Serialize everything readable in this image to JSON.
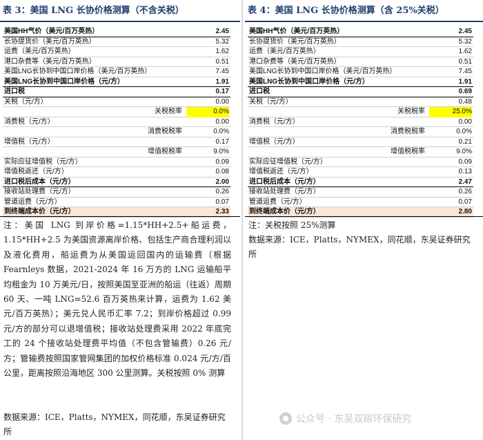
{
  "left": {
    "title": "表 3：美国 LNG 长协价格测算（不含关税）",
    "rows": [
      {
        "label": "美国HH气价（美元/百万英热）",
        "value": "2.45",
        "style": "b"
      },
      {
        "label": "长协提货价（美元/百万英热）",
        "value": "5.32",
        "style": ""
      },
      {
        "label": "运费（美元/百万英热）",
        "value": "1.62",
        "style": ""
      },
      {
        "label": "港口杂费等（美元/百万英热）",
        "value": "0.51",
        "style": ""
      },
      {
        "label": "美国LNG长协到中国口岸价格（美元/百万英热）",
        "value": "7.45",
        "style": ""
      },
      {
        "label": "美国LNG长协到中国口岸价格（元/方）",
        "value": "1.91",
        "style": "b"
      },
      {
        "label": "进口税",
        "value": "0.17",
        "style": "b"
      },
      {
        "label": "关税（元/方）",
        "value": "0.00",
        "style": ""
      },
      {
        "label": "关税税率",
        "value": "0.0%",
        "style": "ind hl"
      },
      {
        "label": "消费税（元/方）",
        "value": "0.00",
        "style": ""
      },
      {
        "label": "消费税税率",
        "value": "0.0%",
        "style": "ind"
      },
      {
        "label": "增值税（元/方）",
        "value": "0.17",
        "style": ""
      },
      {
        "label": "增值税税率",
        "value": "9.0%",
        "style": "ind"
      },
      {
        "label": "实际应征增值税（元/方）",
        "value": "0.09",
        "style": ""
      },
      {
        "label": "增值税返还（元/方）",
        "value": "0.08",
        "style": ""
      },
      {
        "label": "进口税后成本（元/方）",
        "value": "2.00",
        "style": "b"
      },
      {
        "label": "接收站处理费（元/方）",
        "value": "0.26",
        "style": ""
      },
      {
        "label": "管道运费（元/方）",
        "value": "0.07",
        "style": ""
      },
      {
        "label": "到终端成本价（元/方）",
        "value": "2.33",
        "style": "total"
      }
    ],
    "note": "注：美国 LNG 到岸价格=1.15*HH+2.5+船运费，1.15*HH+2.5 为美国资源离岸价格、包括生产商合理利润以及液化费用，船运费为从美国运回国内的运输费（根据 Fearnleys 数据，2021-2024 年 16 万方的 LNG 运输船平均租金为 10 万美元/日，按照美国至亚洲的船运（往返）周期 60 天、一吨 LNG=52.6 百万英热来计算，运费为 1.62 美元/百万英热）；美元兑人民币汇率 7.2；到岸价格超过 0.99 元/方的部分可以退增值税；接收站处理费采用 2022 年底完工的 24 个接收站处理费平均值（不包含管输费）0.26 元/方；管输费按照国家管网集团的加权价格标准 0.024 元/方/百公里，距离按照沿海地区 300 公里测算。关税按照 0% 测算",
    "source": "数据来源：ICE，Platts，NYMEX，同花顺，东吴证券研究所"
  },
  "right": {
    "title": "表 4：美国 LNG 长协价格测算（含 25%关税）",
    "rows": [
      {
        "label": "美国HH气价（美元/百万英热）",
        "value": "2.45",
        "style": "b"
      },
      {
        "label": "长协提货价（美元/百万英热）",
        "value": "5.32",
        "style": ""
      },
      {
        "label": "运费（美元/百万英热）",
        "value": "1.62",
        "style": ""
      },
      {
        "label": "港口杂费等（美元/百万英热）",
        "value": "0.51",
        "style": ""
      },
      {
        "label": "美国LNG长协到中国口岸价格（美元/百万英热）",
        "value": "7.45",
        "style": ""
      },
      {
        "label": "美国LNG长协到中国口岸价格（元/方）",
        "value": "1.91",
        "style": "b"
      },
      {
        "label": "进口税",
        "value": "0.69",
        "style": "b"
      },
      {
        "label": "关税（元/方）",
        "value": "0.48",
        "style": ""
      },
      {
        "label": "关税税率",
        "value": "25.0%",
        "style": "ind hl"
      },
      {
        "label": "消费税（元/方）",
        "value": "0.00",
        "style": ""
      },
      {
        "label": "消费税税率",
        "value": "0.0%",
        "style": "ind"
      },
      {
        "label": "增值税（元/方）",
        "value": "0.21",
        "style": ""
      },
      {
        "label": "增值税税率",
        "value": "9.0%",
        "style": "ind"
      },
      {
        "label": "实际应征增值税（元/方）",
        "value": "0.09",
        "style": ""
      },
      {
        "label": "增值税返还（元/方）",
        "value": "0.13",
        "style": ""
      },
      {
        "label": "进口税后成本（元/方）",
        "value": "2.47",
        "style": "b"
      },
      {
        "label": "接收站处理费（元/方）",
        "value": "0.26",
        "style": ""
      },
      {
        "label": "管道运费（元/方）",
        "value": "0.07",
        "style": ""
      },
      {
        "label": "到终端成本价（元/方）",
        "value": "2.80",
        "style": "total"
      }
    ],
    "note": "注：关税按照 25%测算",
    "source": "数据来源：ICE，Platts，NYMEX，同花顺，东吴证券研究所"
  },
  "watermark": "公众号 · 东吴双碳环保研究",
  "colors": {
    "title": "#1f3f6e",
    "highlight": "#ffff00",
    "total_row": "#fbe5d6"
  }
}
